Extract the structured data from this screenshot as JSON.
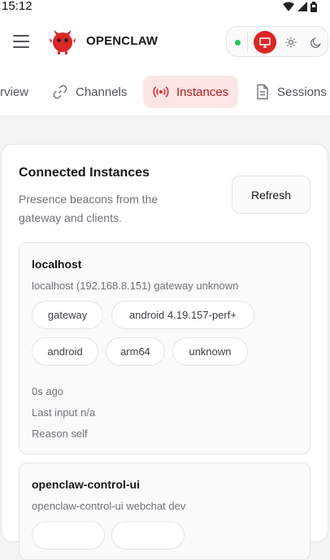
{
  "status_bar": {
    "time": "15:12"
  },
  "header": {
    "brand": "OPENCLAW",
    "connection_status_color": "#22c55e",
    "accent_color": "#dc2626",
    "theme_modes": [
      "system",
      "light",
      "dark"
    ],
    "active_theme": "system"
  },
  "tabs": [
    {
      "label": "rview",
      "icon": "overview-icon"
    },
    {
      "label": "Channels",
      "icon": "link-icon"
    },
    {
      "label": "Instances",
      "icon": "broadcast-icon",
      "active": true
    },
    {
      "label": "Sessions",
      "icon": "document-icon"
    }
  ],
  "panel": {
    "title": "Connected Instances",
    "subtitle": "Presence beacons from the gateway and clients.",
    "refresh_label": "Refresh"
  },
  "instances": [
    {
      "name": "localhost",
      "detail": "localhost (192.168.8.151) gateway unknown",
      "chips": [
        "gateway",
        "android 4.19.157-perf+",
        "android",
        "arm64",
        "unknown"
      ],
      "age": "0s ago",
      "last_input": "Last input n/a",
      "reason": "Reason self"
    },
    {
      "name": "openclaw-control-ui",
      "detail": "openclaw-control-ui webchat dev"
    }
  ]
}
